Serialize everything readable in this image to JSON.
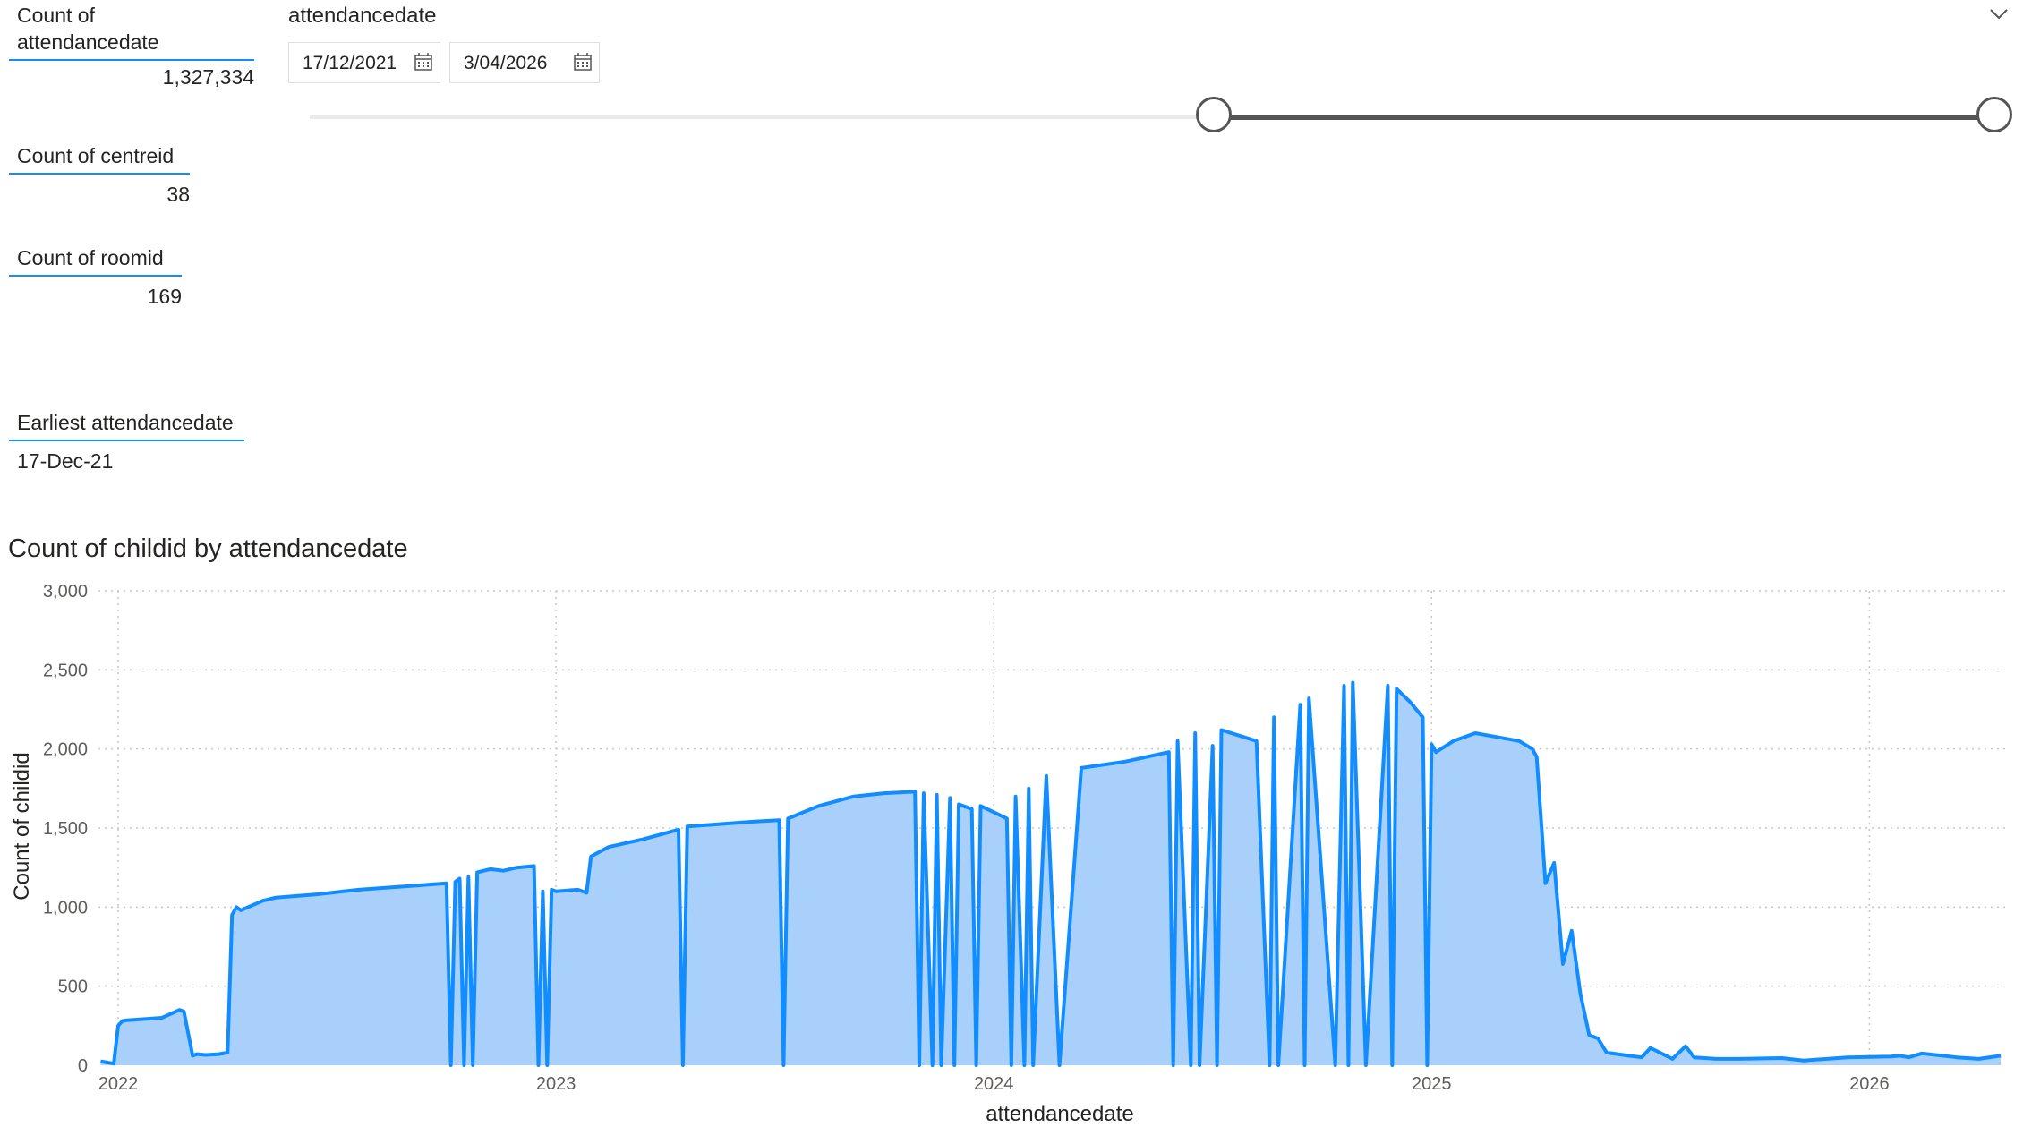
{
  "cards": [
    {
      "label": "Count of\nattendancedate",
      "value": "1,327,334"
    },
    {
      "label": "Count of centreid",
      "value": "38"
    },
    {
      "label": "Count of roomid",
      "value": "169"
    },
    {
      "label": "Earliest attendancedate",
      "value": "17-Dec-21"
    }
  ],
  "slicer": {
    "title": "attendancedate",
    "start_date": "17/12/2021",
    "end_date": "3/04/2026",
    "start_fraction": 0.54,
    "end_fraction": 1.0
  },
  "chart_data": {
    "type": "area",
    "title": "Count of childid by attendancedate",
    "xlabel": "attendancedate",
    "ylabel": "Count of childid",
    "ylim": [
      0,
      3000
    ],
    "yticks": [
      "0",
      "500",
      "1,000",
      "1,500",
      "2,000",
      "2,500",
      "3,000"
    ],
    "xticks": [
      "2022",
      "2023",
      "2024",
      "2025",
      "2026"
    ],
    "xlim": [
      2021.955,
      2026.31
    ],
    "grid": true,
    "colors": {
      "line": "#118dff",
      "fill": "#a9d0fb"
    },
    "x": [
      2021.96,
      2021.97,
      2021.99,
      2022.0,
      2022.01,
      2022.02,
      2022.05,
      2022.1,
      2022.14,
      2022.15,
      2022.17,
      2022.18,
      2022.2,
      2022.23,
      2022.25,
      2022.26,
      2022.27,
      2022.28,
      2022.33,
      2022.36,
      2022.45,
      2022.55,
      2022.65,
      2022.75,
      2022.76,
      2022.77,
      2022.78,
      2022.79,
      2022.8,
      2022.81,
      2022.82,
      2022.85,
      2022.88,
      2022.91,
      2022.95,
      2022.96,
      2022.97,
      2022.98,
      2022.99,
      2023.0,
      2023.05,
      2023.07,
      2023.08,
      2023.12,
      2023.2,
      2023.28,
      2023.29,
      2023.3,
      2023.35,
      2023.45,
      2023.51,
      2023.52,
      2023.53,
      2023.6,
      2023.68,
      2023.75,
      2023.82,
      2023.83,
      2023.84,
      2023.86,
      2023.87,
      2023.88,
      2023.9,
      2023.91,
      2023.92,
      2023.95,
      2023.96,
      2023.97,
      2024.0,
      2024.03,
      2024.04,
      2024.05,
      2024.07,
      2024.08,
      2024.09,
      2024.12,
      2024.15,
      2024.2,
      2024.3,
      2024.4,
      2024.41,
      2024.42,
      2024.45,
      2024.46,
      2024.47,
      2024.5,
      2024.51,
      2024.52,
      2024.6,
      2024.63,
      2024.64,
      2024.65,
      2024.7,
      2024.71,
      2024.72,
      2024.78,
      2024.8,
      2024.81,
      2024.82,
      2024.85,
      2024.9,
      2024.91,
      2024.92,
      2024.95,
      2024.98,
      2024.99,
      2025.0,
      2025.01,
      2025.05,
      2025.1,
      2025.2,
      2025.23,
      2025.24,
      2025.26,
      2025.28,
      2025.3,
      2025.32,
      2025.34,
      2025.36,
      2025.38,
      2025.4,
      2025.45,
      2025.48,
      2025.5,
      2025.55,
      2025.58,
      2025.6,
      2025.65,
      2025.7,
      2025.8,
      2025.85,
      2025.95,
      2026.05,
      2026.07,
      2026.09,
      2026.12,
      2026.2,
      2026.25,
      2026.3
    ],
    "values": [
      25,
      20,
      10,
      250,
      280,
      285,
      290,
      300,
      350,
      340,
      60,
      70,
      65,
      70,
      80,
      950,
      1000,
      980,
      1040,
      1060,
      1080,
      1110,
      1130,
      1150,
      0,
      1160,
      1180,
      0,
      1190,
      0,
      1220,
      1240,
      1230,
      1250,
      1260,
      0,
      1100,
      0,
      1110,
      1100,
      1110,
      1090,
      1320,
      1380,
      1430,
      1490,
      0,
      1510,
      1520,
      1540,
      1550,
      0,
      1560,
      1640,
      1700,
      1720,
      1730,
      0,
      1720,
      0,
      1710,
      0,
      1690,
      0,
      1650,
      1620,
      0,
      1640,
      1600,
      1560,
      0,
      1700,
      0,
      1750,
      0,
      1830,
      0,
      1880,
      1920,
      1980,
      0,
      2050,
      0,
      2100,
      0,
      2020,
      0,
      2120,
      2050,
      0,
      2200,
      0,
      2280,
      0,
      2320,
      0,
      2400,
      0,
      2420,
      0,
      2400,
      0,
      2380,
      2300,
      2200,
      0,
      2030,
      1980,
      2050,
      2100,
      2050,
      2000,
      1950,
      1150,
      1280,
      640,
      850,
      450,
      190,
      170,
      80,
      60,
      50,
      110,
      40,
      120,
      50,
      40,
      40,
      45,
      30,
      50,
      55,
      60,
      50,
      75,
      50,
      40,
      60,
      80
    ]
  }
}
